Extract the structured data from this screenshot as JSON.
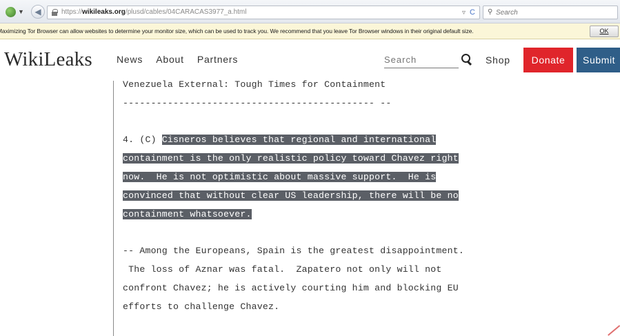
{
  "browser": {
    "url_prefix": "https://",
    "url_domain": "wikileaks.org",
    "url_path": "/plusd/cables/04CARACAS3977_a.html",
    "search_placeholder": "Search",
    "reload_glyph": "C",
    "dropdown_glyph": "▿",
    "back_glyph": "◀"
  },
  "notification": {
    "text": "Maximizing Tor Browser can allow websites to determine your monitor size, which can be used to track you. We recommend that you leave Tor Browser windows in their original default size.",
    "ok_label": "OK"
  },
  "site": {
    "logo": "WikiLeaks",
    "nav": [
      "News",
      "About",
      "Partners"
    ],
    "search_placeholder": "Search",
    "shop": "Shop",
    "donate": "Donate",
    "submit": "Submit"
  },
  "cable": {
    "heading": "Venezuela External: Tough Times for Containment",
    "rule": "--------------------------------------------- --",
    "para4_prefix": "4. (C) ",
    "para4_lines": [
      "Cisneros believes that regional and international",
      "containment is the only realistic policy toward Chavez right",
      "now.  He is not optimistic about massive support.  He is",
      "convinced that without clear US leadership, there will be no",
      "containment whatsoever."
    ],
    "para5_lines": [
      "-- Among the Europeans, Spain is the greatest disappointment.",
      " The loss of Aznar was fatal.  Zapatero not only will not",
      "confront Chavez; he is actively courting him and blocking EU",
      "efforts to challenge Chavez."
    ]
  },
  "colors": {
    "donate": "#e0252b",
    "submit": "#2f5e88",
    "highlight": "#5b5f66",
    "notification_bg": "#fbf6d8"
  },
  "icons": [
    "tor-globe-icon",
    "back-arrow-icon",
    "lock-icon",
    "reload-icon",
    "search-icon"
  ]
}
